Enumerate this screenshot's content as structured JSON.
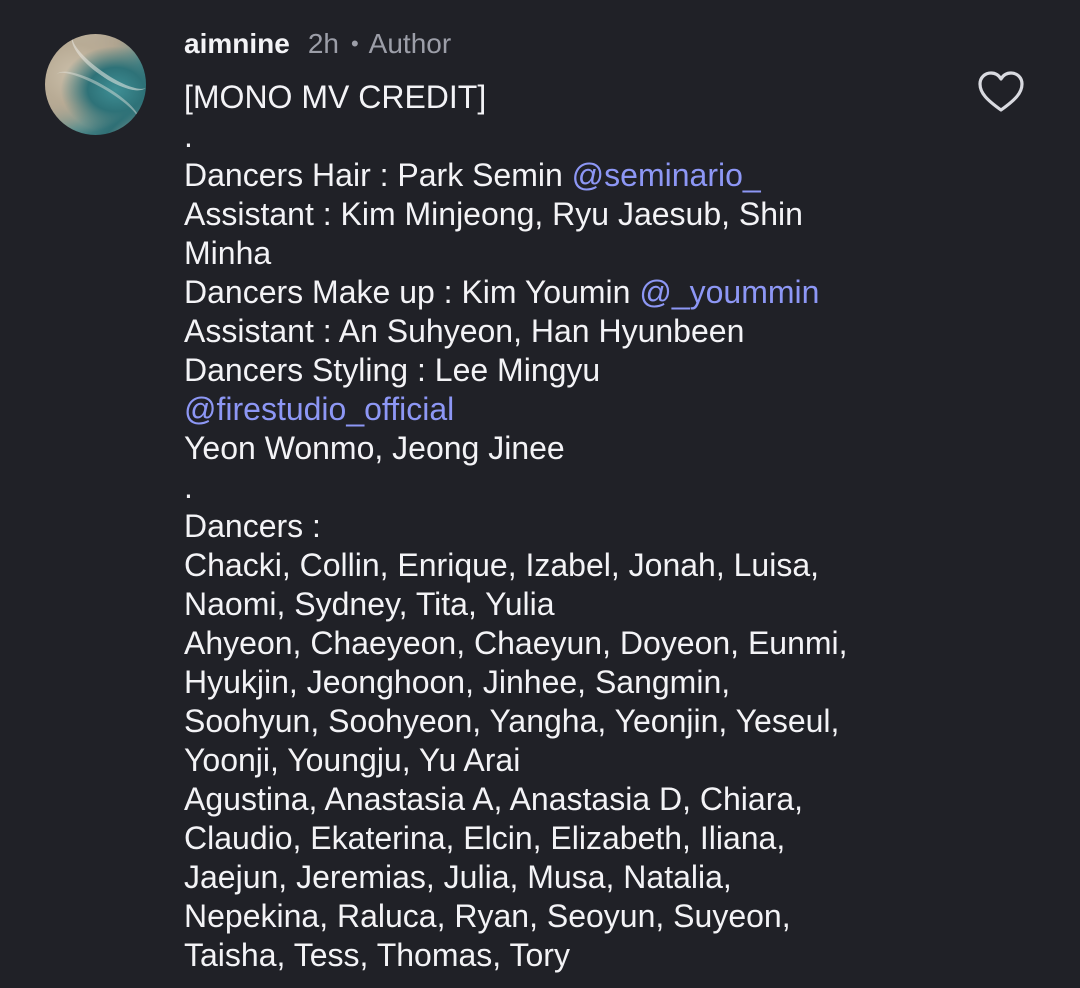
{
  "comment": {
    "username": "aimnine",
    "time": "2h",
    "separator": "•",
    "role": "Author",
    "avatar_icon": "beach-aerial-photo-avatar",
    "like_icon": "heart-outline-icon",
    "lines": {
      "l01": "[MONO MV CREDIT]",
      "l02": ".",
      "l03_text": "Dancers Hair : Park Semin ",
      "l03_mention": "@seminario_",
      "l04": "Assistant : Kim Minjeong, Ryu Jaesub, Shin",
      "l05": "Minha",
      "l06_text": "Dancers Make up : Kim Youmin ",
      "l06_mention": "@_yoummin",
      "l07": "Assistant : An Suhyeon, Han Hyunbeen",
      "l08": "Dancers Styling : Lee Mingyu",
      "l09_mention": "@firestudio_official",
      "l10": "Yeon Wonmo, Jeong Jinee",
      "l11": ".",
      "l12": "Dancers :",
      "l13": "Chacki, Collin, Enrique, Izabel, Jonah, Luisa,",
      "l14": "Naomi, Sydney, Tita, Yulia",
      "l15": "Ahyeon, Chaeyeon, Chaeyun, Doyeon, Eunmi,",
      "l16": "Hyukjin, Jeonghoon, Jinhee, Sangmin,",
      "l17": "Soohyun, Soohyeon, Yangha, Yeonjin, Yeseul,",
      "l18": "Yoonji, Youngju, Yu Arai",
      "l19": "Agustina, Anastasia A, Anastasia D, Chiara,",
      "l20": "Claudio, Ekaterina, Elcin, Elizabeth, Iliana,",
      "l21": "Jaejun, Jeremias, Julia, Musa, Natalia,",
      "l22": "Nepekina, Raluca, Ryan, Seoyun, Suyeon,",
      "l23": "Taisha, Tess, Thomas, Tory"
    }
  },
  "colors": {
    "background": "#202127",
    "text": "#f3f3f6",
    "secondary": "#9c9ea8",
    "mention": "#8d97f5"
  }
}
